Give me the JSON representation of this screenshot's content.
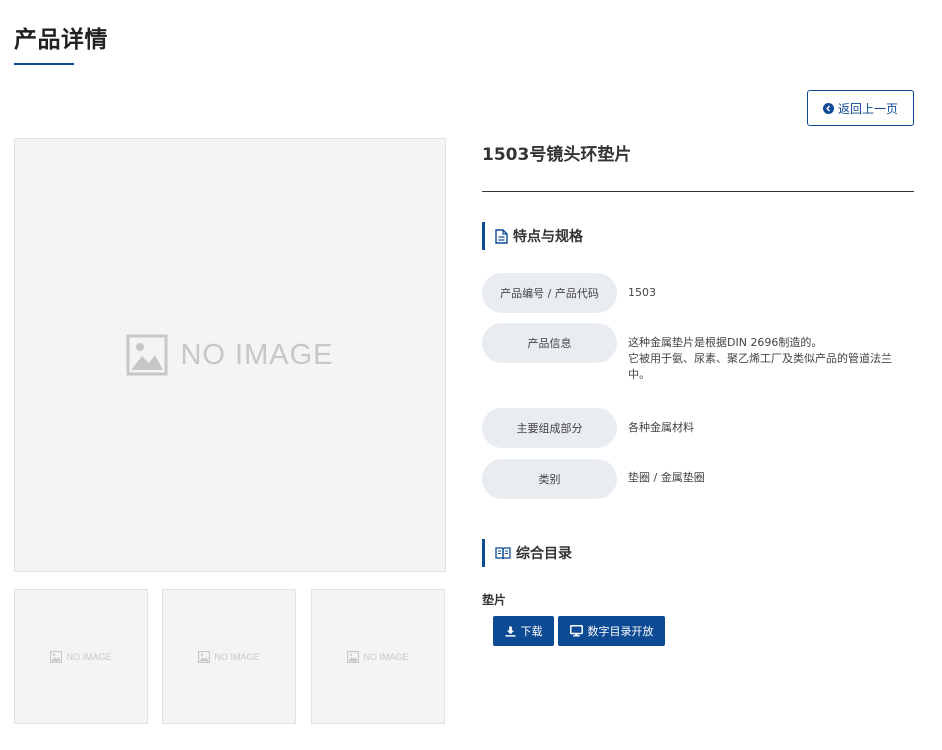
{
  "page": {
    "title": "产品详情",
    "back_label": "返回上一页"
  },
  "gallery": {
    "main_placeholder": "NO IMAGE",
    "thumb_placeholders": [
      "NO IMAGE",
      "NO IMAGE",
      "NO IMAGE"
    ]
  },
  "product": {
    "name": "1503号镜头环垫片",
    "features_heading": "特点与规格",
    "specs": [
      {
        "label": "产品编号 / 产品代码",
        "value": "1503"
      },
      {
        "label": "产品信息",
        "value": "这种金属垫片是根据DIN 2696制造的。",
        "value_line2": "它被用于氨、尿素、聚乙烯工厂及类似产品的管道法兰中。"
      },
      {
        "label": "主要组成部分",
        "value": "各种金属材料"
      },
      {
        "label": "类别",
        "value": "垫圈 / 金属垫圈"
      }
    ]
  },
  "catalog": {
    "heading": "综合目录",
    "item_name": "垫片",
    "download_label": "下载",
    "digital_label": "数字目录开放"
  },
  "colors": {
    "primary": "#0d4a94",
    "placeholder_bg": "#f4f4f4",
    "pill_bg": "#e9ecf0"
  },
  "icons": {
    "back": "arrow-left-circle-icon",
    "features": "document-icon",
    "catalog": "book-icon",
    "download": "download-icon",
    "digital": "monitor-icon",
    "placeholder": "image-icon"
  }
}
